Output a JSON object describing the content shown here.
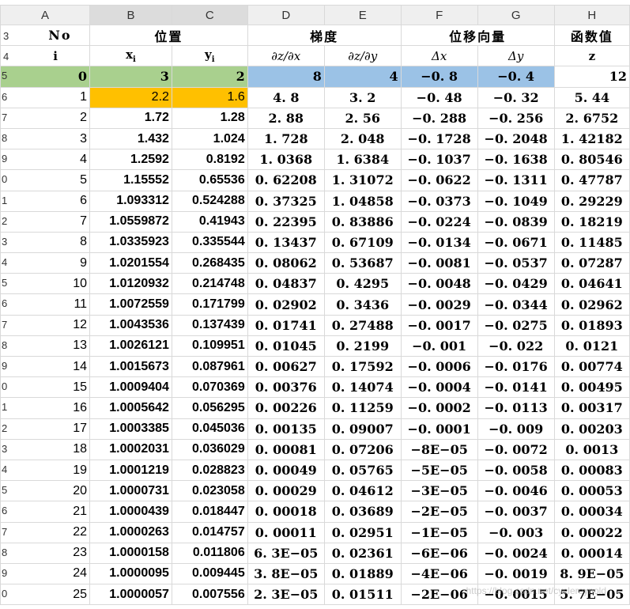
{
  "columns": [
    "A",
    "B",
    "C",
    "D",
    "E",
    "F",
    "G",
    "H"
  ],
  "row_numbers": [
    "3",
    "4",
    "5",
    "6",
    "7",
    "8",
    "9",
    "0",
    "1",
    "2",
    "3",
    "4",
    "5",
    "6",
    "7",
    "8",
    "9",
    "0",
    "1",
    "2",
    "3",
    "4",
    "5",
    "6",
    "7",
    "8",
    "9",
    "0"
  ],
  "header1": {
    "no": "No",
    "position": "位置",
    "gradient": "梯度",
    "displacement": "位移向量",
    "function": "函数值"
  },
  "header2": {
    "i": "i",
    "xi": "x",
    "xi_sub": "i",
    "yi": "y",
    "yi_sub": "i",
    "dzdx": "∂z/∂x",
    "dzdy": "∂z/∂y",
    "dx": "Δx",
    "dy": "Δy",
    "z": "z"
  },
  "rows": [
    {
      "i": "0",
      "x": "3",
      "y": "2",
      "dzdx": "8",
      "dzdy": "4",
      "dx": "−0. 8",
      "dy": "−0. 4",
      "z": "12"
    },
    {
      "i": "1",
      "x": "2.2",
      "y": "1.6",
      "dzdx": "4. 8",
      "dzdy": "3. 2",
      "dx": "−0. 48",
      "dy": "−0. 32",
      "z": "5. 44"
    },
    {
      "i": "2",
      "x": "1.72",
      "y": "1.28",
      "dzdx": "2. 88",
      "dzdy": "2. 56",
      "dx": "−0. 288",
      "dy": "−0. 256",
      "z": "2. 6752"
    },
    {
      "i": "3",
      "x": "1.432",
      "y": "1.024",
      "dzdx": "1. 728",
      "dzdy": "2. 048",
      "dx": "−0. 1728",
      "dy": "−0. 2048",
      "z": "1. 42182"
    },
    {
      "i": "4",
      "x": "1.2592",
      "y": "0.8192",
      "dzdx": "1. 0368",
      "dzdy": "1. 6384",
      "dx": "−0. 1037",
      "dy": "−0. 1638",
      "z": "0. 80546"
    },
    {
      "i": "5",
      "x": "1.15552",
      "y": "0.65536",
      "dzdx": "0. 62208",
      "dzdy": "1. 31072",
      "dx": "−0. 0622",
      "dy": "−0. 1311",
      "z": "0. 47787"
    },
    {
      "i": "6",
      "x": "1.093312",
      "y": "0.524288",
      "dzdx": "0. 37325",
      "dzdy": "1. 04858",
      "dx": "−0. 0373",
      "dy": "−0. 1049",
      "z": "0. 29229"
    },
    {
      "i": "7",
      "x": "1.0559872",
      "y": "0.41943",
      "dzdx": "0. 22395",
      "dzdy": "0. 83886",
      "dx": "−0. 0224",
      "dy": "−0. 0839",
      "z": "0. 18219"
    },
    {
      "i": "8",
      "x": "1.0335923",
      "y": "0.335544",
      "dzdx": "0. 13437",
      "dzdy": "0. 67109",
      "dx": "−0. 0134",
      "dy": "−0. 0671",
      "z": "0. 11485"
    },
    {
      "i": "9",
      "x": "1.0201554",
      "y": "0.268435",
      "dzdx": "0. 08062",
      "dzdy": "0. 53687",
      "dx": "−0. 0081",
      "dy": "−0. 0537",
      "z": "0. 07287"
    },
    {
      "i": "10",
      "x": "1.0120932",
      "y": "0.214748",
      "dzdx": "0. 04837",
      "dzdy": "0. 4295",
      "dx": "−0. 0048",
      "dy": "−0. 0429",
      "z": "0. 04641"
    },
    {
      "i": "11",
      "x": "1.0072559",
      "y": "0.171799",
      "dzdx": "0. 02902",
      "dzdy": "0. 3436",
      "dx": "−0. 0029",
      "dy": "−0. 0344",
      "z": "0. 02962"
    },
    {
      "i": "12",
      "x": "1.0043536",
      "y": "0.137439",
      "dzdx": "0. 01741",
      "dzdy": "0. 27488",
      "dx": "−0. 0017",
      "dy": "−0. 0275",
      "z": "0. 01893"
    },
    {
      "i": "13",
      "x": "1.0026121",
      "y": "0.109951",
      "dzdx": "0. 01045",
      "dzdy": "0. 2199",
      "dx": "−0. 001",
      "dy": "−0. 022",
      "z": "0. 0121"
    },
    {
      "i": "14",
      "x": "1.0015673",
      "y": "0.087961",
      "dzdx": "0. 00627",
      "dzdy": "0. 17592",
      "dx": "−0. 0006",
      "dy": "−0. 0176",
      "z": "0. 00774"
    },
    {
      "i": "15",
      "x": "1.0009404",
      "y": "0.070369",
      "dzdx": "0. 00376",
      "dzdy": "0. 14074",
      "dx": "−0. 0004",
      "dy": "−0. 0141",
      "z": "0. 00495"
    },
    {
      "i": "16",
      "x": "1.0005642",
      "y": "0.056295",
      "dzdx": "0. 00226",
      "dzdy": "0. 11259",
      "dx": "−0. 0002",
      "dy": "−0. 0113",
      "z": "0. 00317"
    },
    {
      "i": "17",
      "x": "1.0003385",
      "y": "0.045036",
      "dzdx": "0. 00135",
      "dzdy": "0. 09007",
      "dx": "−0. 0001",
      "dy": "−0. 009",
      "z": "0. 00203"
    },
    {
      "i": "18",
      "x": "1.0002031",
      "y": "0.036029",
      "dzdx": "0. 00081",
      "dzdy": "0. 07206",
      "dx": "−8E−05",
      "dy": "−0. 0072",
      "z": "0. 0013"
    },
    {
      "i": "19",
      "x": "1.0001219",
      "y": "0.028823",
      "dzdx": "0. 00049",
      "dzdy": "0. 05765",
      "dx": "−5E−05",
      "dy": "−0. 0058",
      "z": "0. 00083"
    },
    {
      "i": "20",
      "x": "1.0000731",
      "y": "0.023058",
      "dzdx": "0. 00029",
      "dzdy": "0. 04612",
      "dx": "−3E−05",
      "dy": "−0. 0046",
      "z": "0. 00053"
    },
    {
      "i": "21",
      "x": "1.0000439",
      "y": "0.018447",
      "dzdx": "0. 00018",
      "dzdy": "0. 03689",
      "dx": "−2E−05",
      "dy": "−0. 0037",
      "z": "0. 00034"
    },
    {
      "i": "22",
      "x": "1.0000263",
      "y": "0.014757",
      "dzdx": "0. 00011",
      "dzdy": "0. 02951",
      "dx": "−1E−05",
      "dy": "−0. 003",
      "z": "0. 00022"
    },
    {
      "i": "23",
      "x": "1.0000158",
      "y": "0.011806",
      "dzdx": "6. 3E−05",
      "dzdy": "0. 02361",
      "dx": "−6E−06",
      "dy": "−0. 0024",
      "z": "0. 00014"
    },
    {
      "i": "24",
      "x": "1.0000095",
      "y": "0.009445",
      "dzdx": "3. 8E−05",
      "dzdy": "0. 01889",
      "dx": "−4E−06",
      "dy": "−0. 0019",
      "z": "8. 9E−05"
    },
    {
      "i": "25",
      "x": "1.0000057",
      "y": "0.007556",
      "dzdx": "2. 3E−05",
      "dzdy": "0. 01511",
      "dx": "−2E−06",
      "dy": "−0. 0015",
      "z": "5. 7E−05"
    }
  ],
  "watermark": "https://blog.csdn.net/cyclereynold",
  "colors": {
    "start_row": "#a9d08e",
    "gradient_start": "#9bc2e6",
    "highlight": "#ffc000"
  }
}
